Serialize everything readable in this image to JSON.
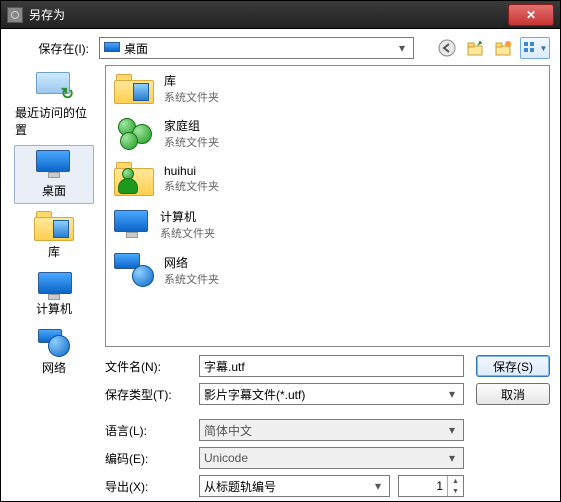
{
  "title": "另存为",
  "savein_label": "保存在(I):",
  "savein_value": "桌面",
  "history_tools": {
    "back": "back-icon",
    "up": "up-icon",
    "newfolder": "new-folder-icon",
    "view": "view-icon"
  },
  "sidebar": {
    "items": [
      {
        "label": "最近访问的位置",
        "key": "recent"
      },
      {
        "label": "桌面",
        "key": "desktop",
        "selected": true
      },
      {
        "label": "库",
        "key": "libraries"
      },
      {
        "label": "计算机",
        "key": "computer"
      },
      {
        "label": "网络",
        "key": "network"
      }
    ]
  },
  "filelist": [
    {
      "name": "库",
      "sub": "系统文件夹",
      "icon": "libraries"
    },
    {
      "name": "家庭组",
      "sub": "系统文件夹",
      "icon": "homegroup"
    },
    {
      "name": "huihui",
      "sub": "系统文件夹",
      "icon": "user"
    },
    {
      "name": "计算机",
      "sub": "系统文件夹",
      "icon": "computer"
    },
    {
      "name": "网络",
      "sub": "系统文件夹",
      "icon": "network"
    }
  ],
  "filename_label": "文件名(N):",
  "filename_value": "字幕.utf",
  "filetype_label": "保存类型(T):",
  "filetype_value": "影片字幕文件(*.utf)",
  "btn_save": "保存(S)",
  "btn_cancel": "取消",
  "lang_label": "语言(L):",
  "lang_value": "简体中文",
  "enc_label": "编码(E):",
  "enc_value": "Unicode",
  "export_label": "导出(X):",
  "export_value": "从标题轨编号",
  "export_num": "1"
}
